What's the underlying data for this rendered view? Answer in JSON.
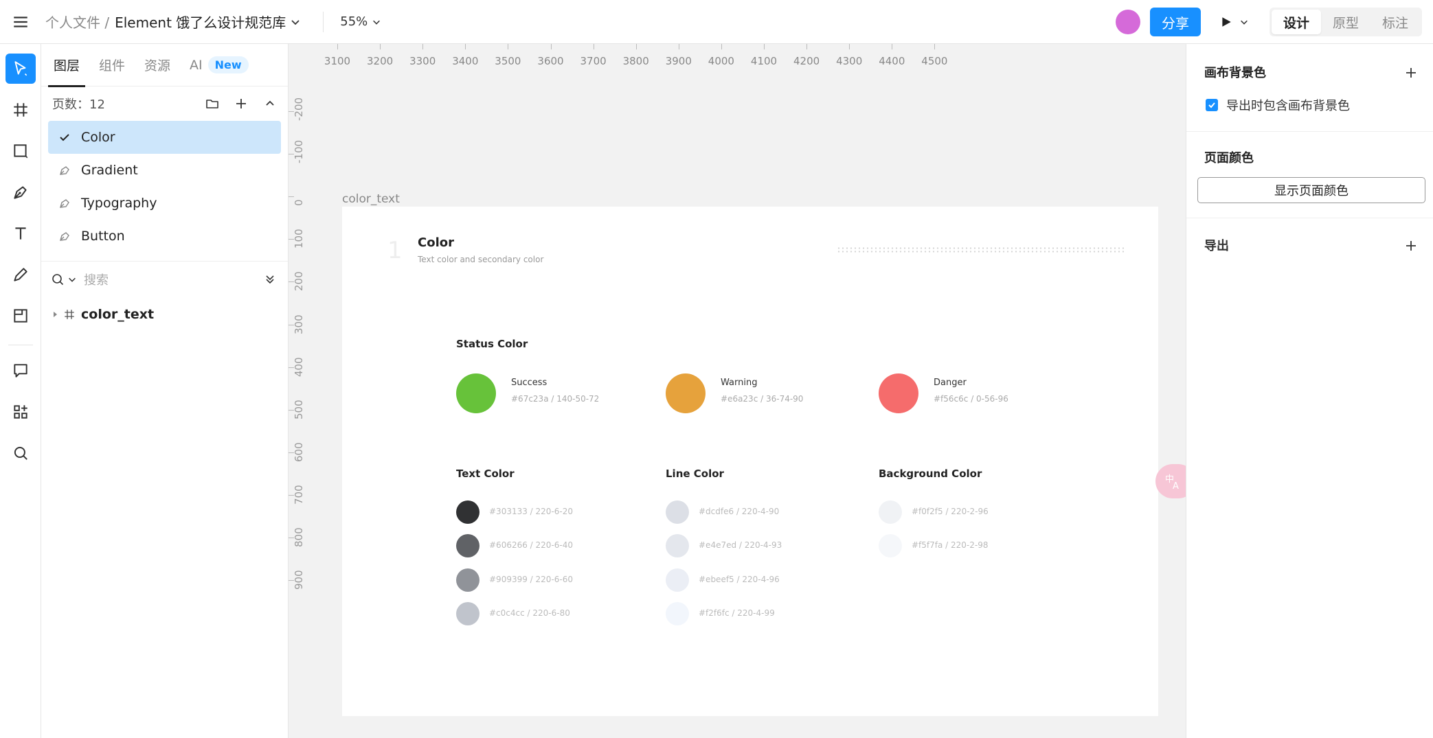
{
  "header": {
    "breadcrumb_root": "个人文件 /",
    "file_name": "Element 饿了么设计规范库",
    "zoom": "55%",
    "share_label": "分享",
    "modes": [
      "设计",
      "原型",
      "标注"
    ],
    "active_mode": "设计",
    "avatar_color": "#d56ad9"
  },
  "layers": {
    "tabs": [
      "图层",
      "组件",
      "资源",
      "AI"
    ],
    "new_badge": "New",
    "pages_count_label": "页数：12",
    "pages": [
      "Color",
      "Gradient",
      "Typography",
      "Button"
    ],
    "active_page": "Color",
    "search_placeholder": "搜索",
    "tree_item": "color_text"
  },
  "canvas": {
    "ruler_top": [
      "3100",
      "3200",
      "3300",
      "3400",
      "3500",
      "3600",
      "3700",
      "3800",
      "3900",
      "4000",
      "4100",
      "4200",
      "4300",
      "4400",
      "4500"
    ],
    "ruler_left": [
      "-200",
      "-100",
      "0",
      "100",
      "200",
      "300",
      "400",
      "500",
      "600",
      "700",
      "800",
      "900"
    ],
    "frame_label": "color_text",
    "section": {
      "number": "1",
      "title": "Color",
      "subtitle": "Text color and secondary color"
    },
    "status": {
      "title": "Status Color",
      "items": [
        {
          "name": "Success",
          "code": "#67c23a / 140-50-72",
          "color": "#67c23a"
        },
        {
          "name": "Warning",
          "code": "#e6a23c / 36-74-90",
          "color": "#e6a23c"
        },
        {
          "name": "Danger",
          "code": "#f56c6c / 0-56-96",
          "color": "#f56c6c"
        }
      ]
    },
    "text_color": {
      "title": "Text Color",
      "items": [
        {
          "code": "#303133 / 220-6-20",
          "color": "#303133"
        },
        {
          "code": "#606266 / 220-6-40",
          "color": "#606266"
        },
        {
          "code": "#909399 / 220-6-60",
          "color": "#909399"
        },
        {
          "code": "#c0c4cc / 220-6-80",
          "color": "#c0c4cc"
        }
      ]
    },
    "line_color": {
      "title": "Line Color",
      "items": [
        {
          "code": "#dcdfe6 / 220-4-90",
          "color": "#dcdfe6"
        },
        {
          "code": "#e4e7ed / 220-4-93",
          "color": "#e4e7ed"
        },
        {
          "code": "#ebeef5 / 220-4-96",
          "color": "#ebeef5"
        },
        {
          "code": "#f2f6fc / 220-4-99",
          "color": "#f2f6fc"
        }
      ]
    },
    "bg_color": {
      "title": "Background Color",
      "items": [
        {
          "code": "#f0f2f5 / 220-2-96",
          "color": "#f0f2f5"
        },
        {
          "code": "#f5f7fa / 220-2-98",
          "color": "#f5f7fa"
        }
      ]
    }
  },
  "props": {
    "canvas_bg_title": "画布背景色",
    "export_bg_label": "导出时包含画布背景色",
    "page_color_title": "页面颜色",
    "show_page_color_label": "显示页面颜色",
    "export_title": "导出"
  },
  "accent": "#1890ff"
}
